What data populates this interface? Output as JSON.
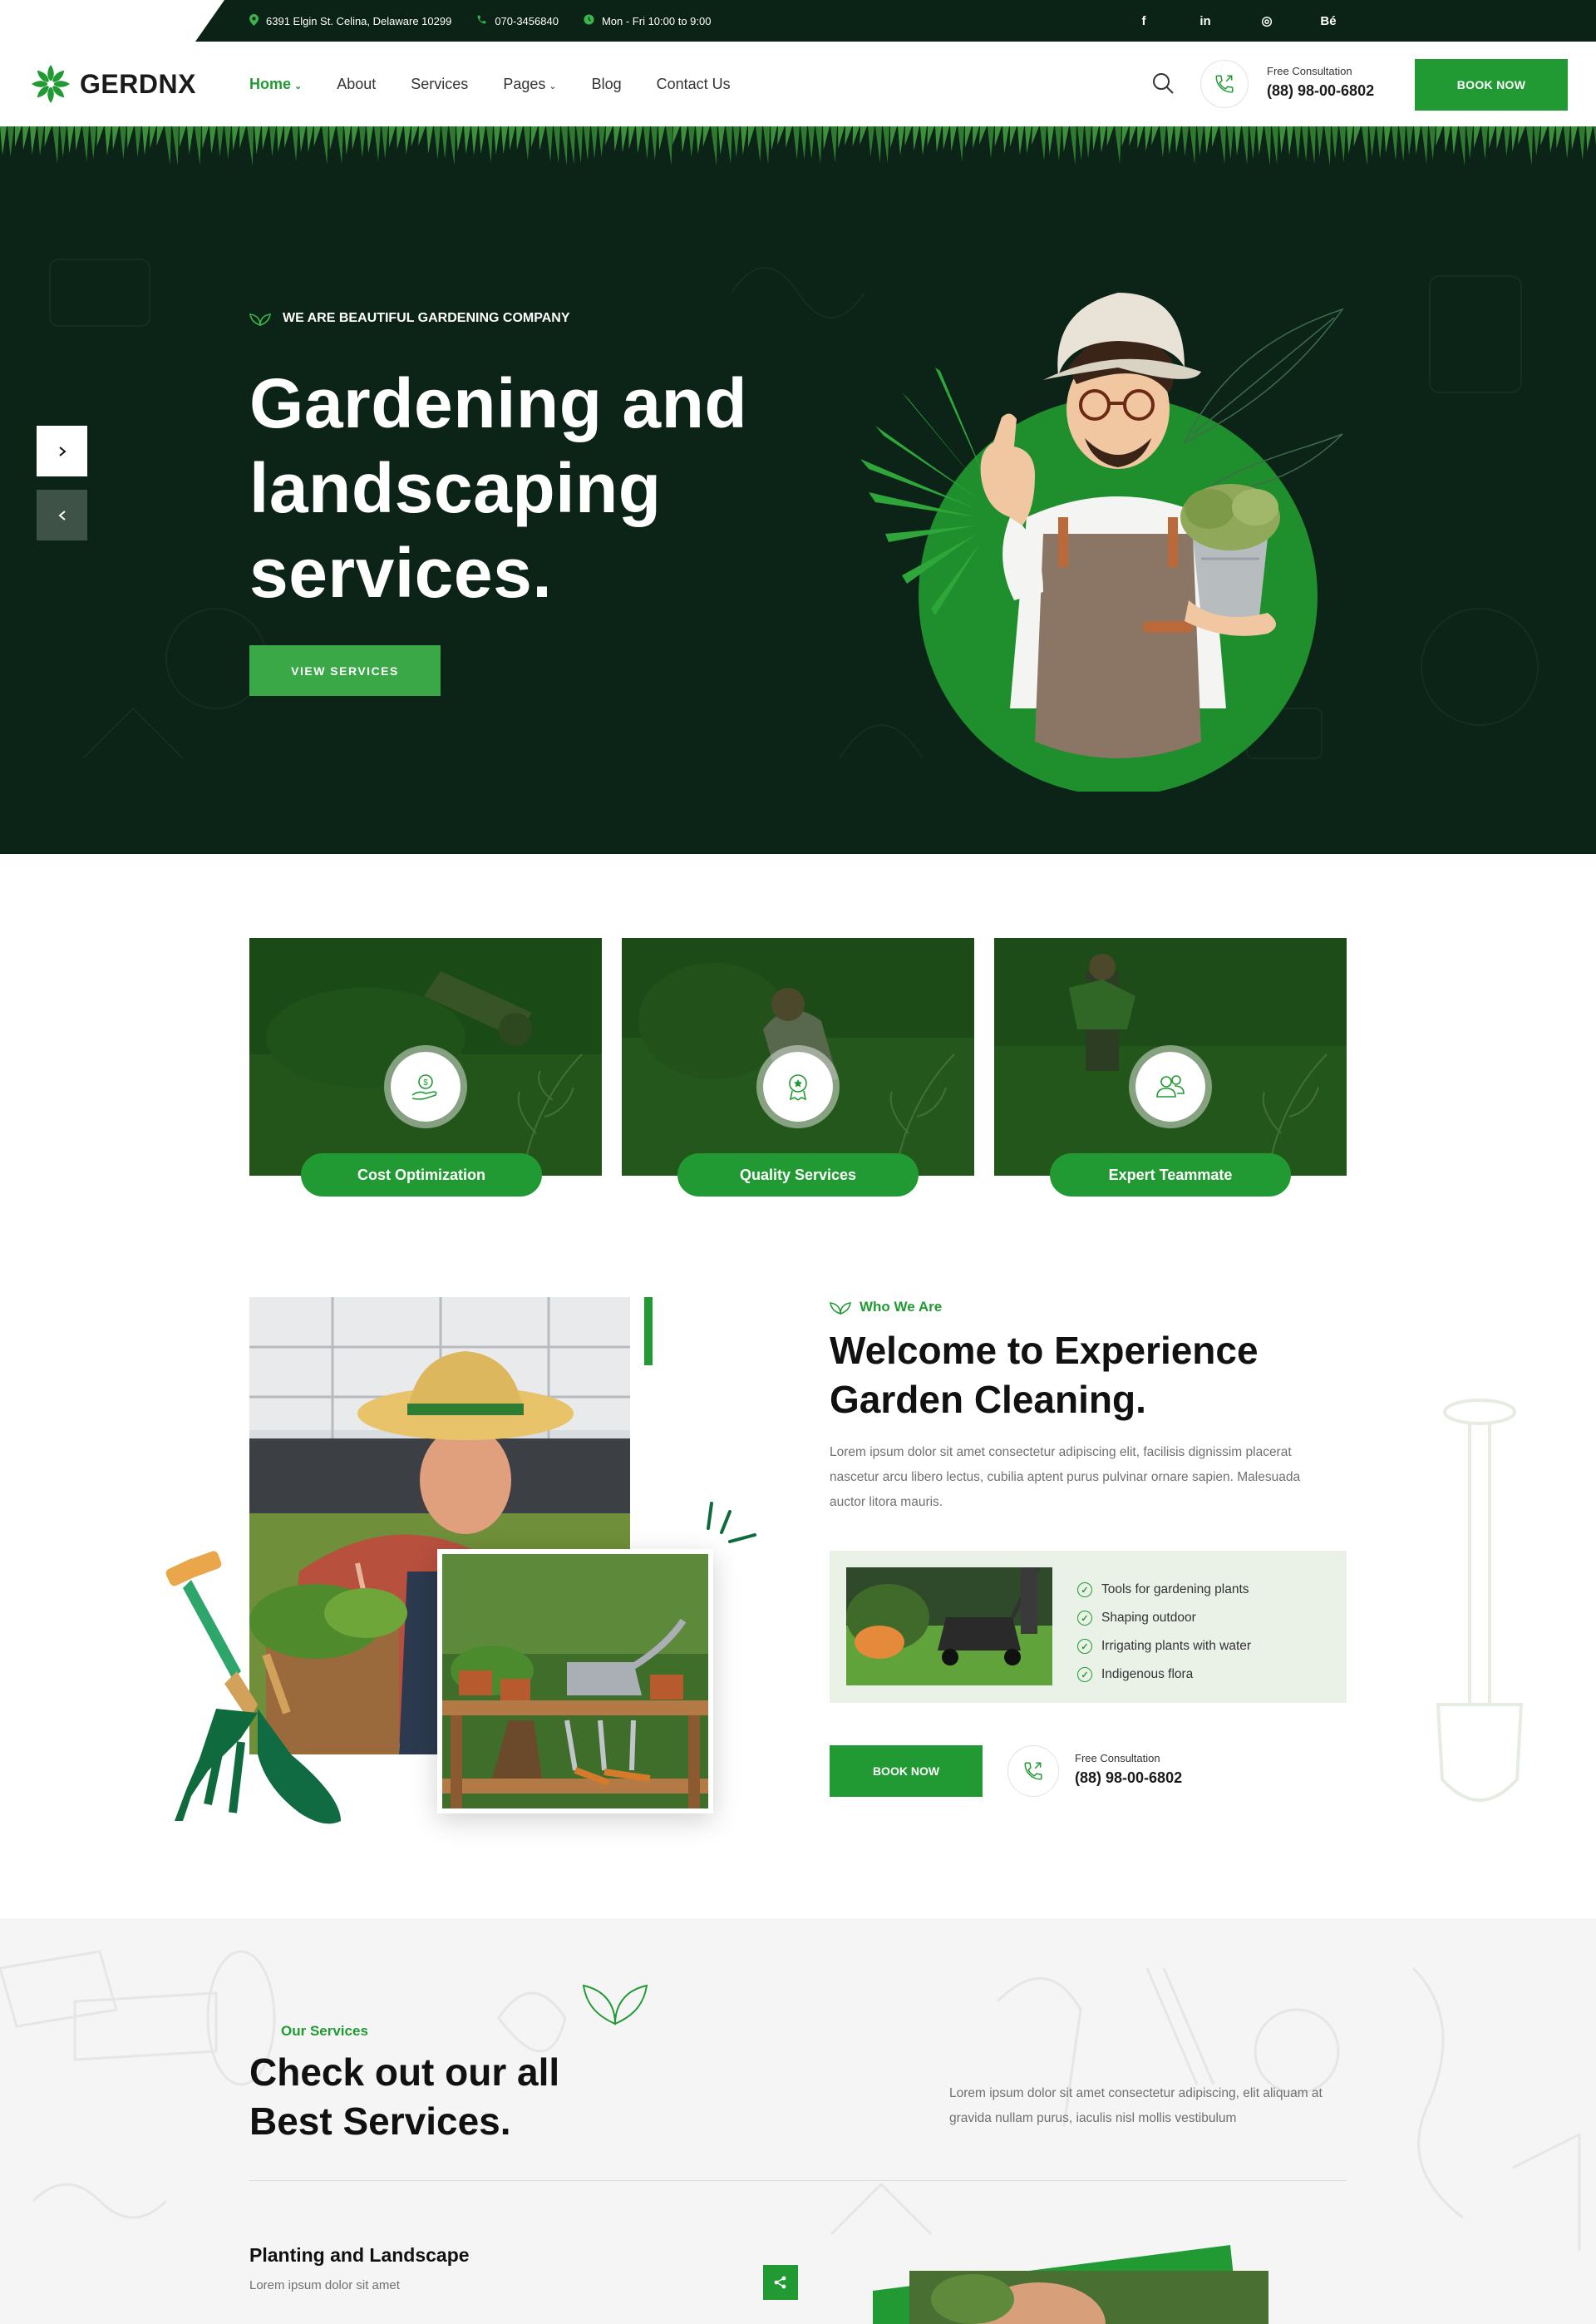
{
  "topbar": {
    "address": "6391 Elgin St. Celina, Delaware 10299",
    "phone": "070-3456840",
    "hours": "Mon - Fri 10:00 to 9:00",
    "social": [
      "f",
      "in",
      "◎",
      "Bé"
    ]
  },
  "header": {
    "logo": "GERDNX",
    "nav": [
      "Home",
      "About",
      "Services",
      "Pages",
      "Blog",
      "Contact Us"
    ],
    "consult_label": "Free Consultation",
    "consult_phone": "(88) 98-00-6802",
    "book_label": "BOOK NOW"
  },
  "hero": {
    "tag": "WE ARE BEAUTIFUL GARDENING COMPANY",
    "title_line1": "Gardening and",
    "title_line2": "landscaping",
    "title_line3": "services.",
    "button": "VIEW SERVICES"
  },
  "features": [
    "Cost Optimization",
    "Quality Services",
    "Expert Teammate"
  ],
  "about": {
    "tag": "Who We Are",
    "title_line1": "Welcome to Experience",
    "title_line2": "Garden Cleaning.",
    "text": "Lorem ipsum dolor sit amet consectetur adipiscing elit, facilisis dignissim placerat nascetur arcu libero lectus, cubilia aptent purus pulvinar ornare sapien. Malesuada auctor litora mauris.",
    "list": [
      "Tools for gardening plants",
      "Shaping outdoor",
      "Irrigating plants with water",
      "Indigenous flora"
    ],
    "book_label": "BOOK NOW",
    "consult_label": "Free Consultation",
    "consult_phone": "(88) 98-00-6802"
  },
  "services": {
    "tag": "Our Services",
    "title_line1": "Check out our all",
    "title_line2": "Best Services.",
    "text": "Lorem ipsum dolor sit amet consectetur adipiscing, elit aliquam at gravida nullam purus, iaculis nisl mollis vestibulum",
    "item_title": "Planting and Landscape",
    "item_sub": "Lorem ipsum dolor sit amet"
  },
  "colors": {
    "primary": "#219a33",
    "dark": "#0c2317",
    "light_green_bg": "#eaf2e8"
  }
}
